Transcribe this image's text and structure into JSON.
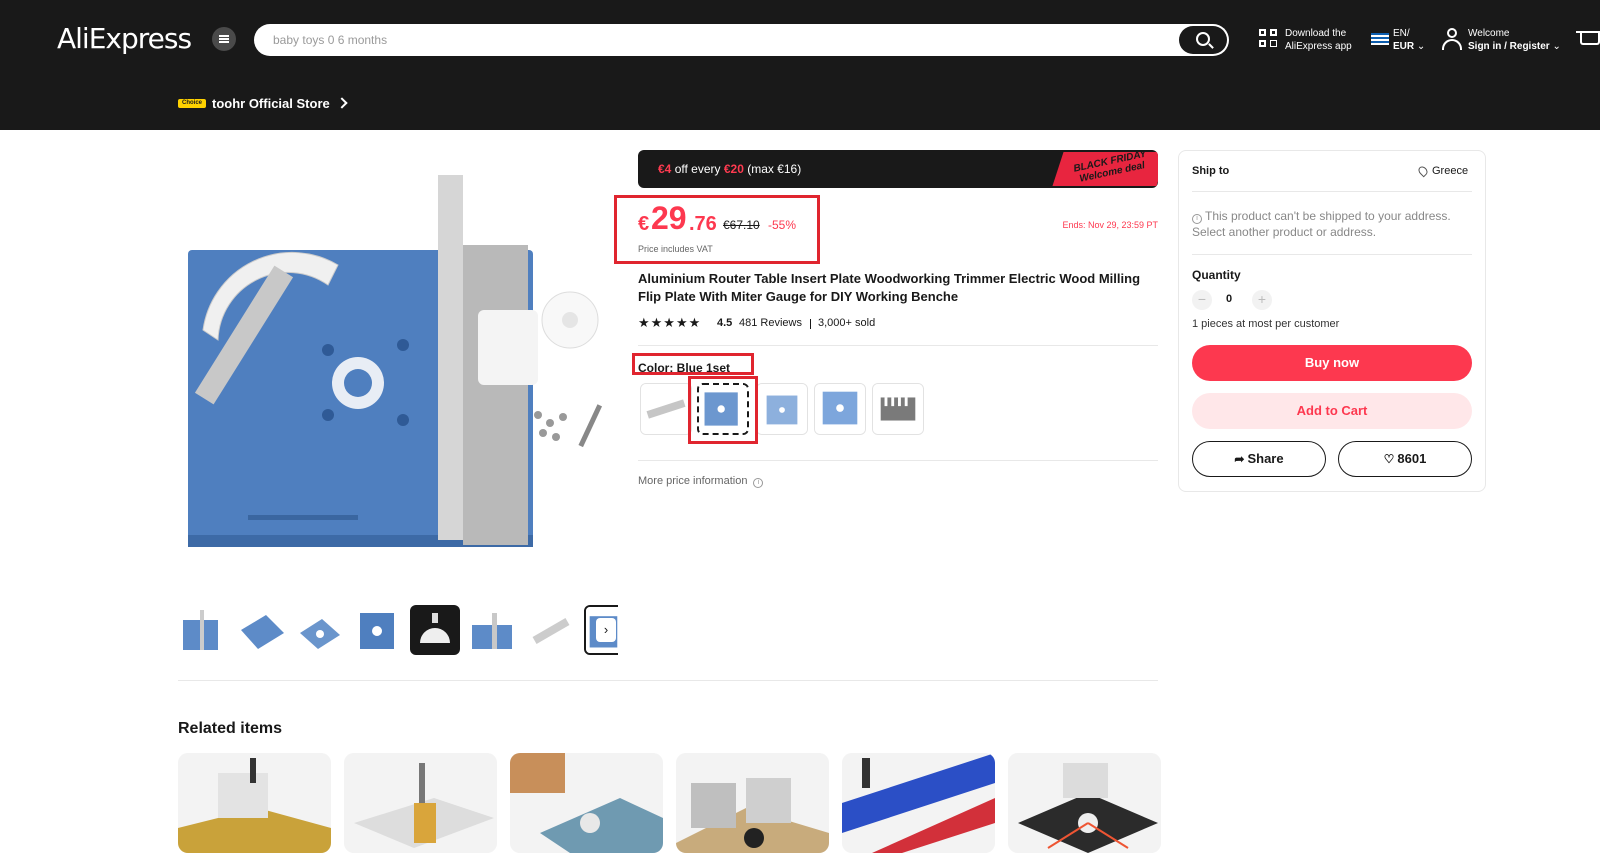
{
  "header": {
    "logo": "AliExpress",
    "search_placeholder": "baby toys 0 6 months",
    "app_line1": "Download the",
    "app_line2": "AliExpress app",
    "lang_line1": "EN/",
    "lang_line2": "EUR",
    "welcome_line1": "Welcome",
    "welcome_line2": "Sign in / Register",
    "store_badge": "Choice",
    "store_name": "toohr Official Store"
  },
  "promo": {
    "amount": "€4",
    "mid": " off every ",
    "threshold": "€20",
    "tail": " (max €16)",
    "tag_line1": "BLACK FRIDAY",
    "tag_line2": "Welcome deal"
  },
  "price": {
    "currency": "€",
    "whole": "29",
    "cents": ".76",
    "old": "€67.10",
    "discount": "-55%",
    "vat": "Price includes VAT",
    "ends": "Ends: Nov 29, 23:59 PT"
  },
  "product": {
    "title": "Aluminium Router Table Insert Plate Woodworking Trimmer Electric Wood Milling Flip Plate With Miter Gauge for DIY Working Benche",
    "stars": "★★★★★",
    "rating": "4.5",
    "reviews": "481 Reviews",
    "sold": "3,000+ sold",
    "color_label": "Color: Blue 1set",
    "more_price": "More price information",
    "sku_selected_index": 1
  },
  "ship": {
    "label": "Ship to",
    "country": "Greece",
    "warning": "This product can't be shipped to your address. Select another product or address.",
    "qty_label": "Quantity",
    "qty_minus": "−",
    "qty_value": "0",
    "qty_plus": "+",
    "qty_limit": "1 pieces at most per customer",
    "buy_now": "Buy now",
    "add_cart": "Add to Cart",
    "share": "Share",
    "favorites": "8601"
  },
  "related": {
    "title": "Related items"
  },
  "colors": {
    "accent": "#fd384f",
    "header_bg": "#191919",
    "highlight_box": "#e0252f",
    "plate_blue": "#4f7fbf"
  }
}
